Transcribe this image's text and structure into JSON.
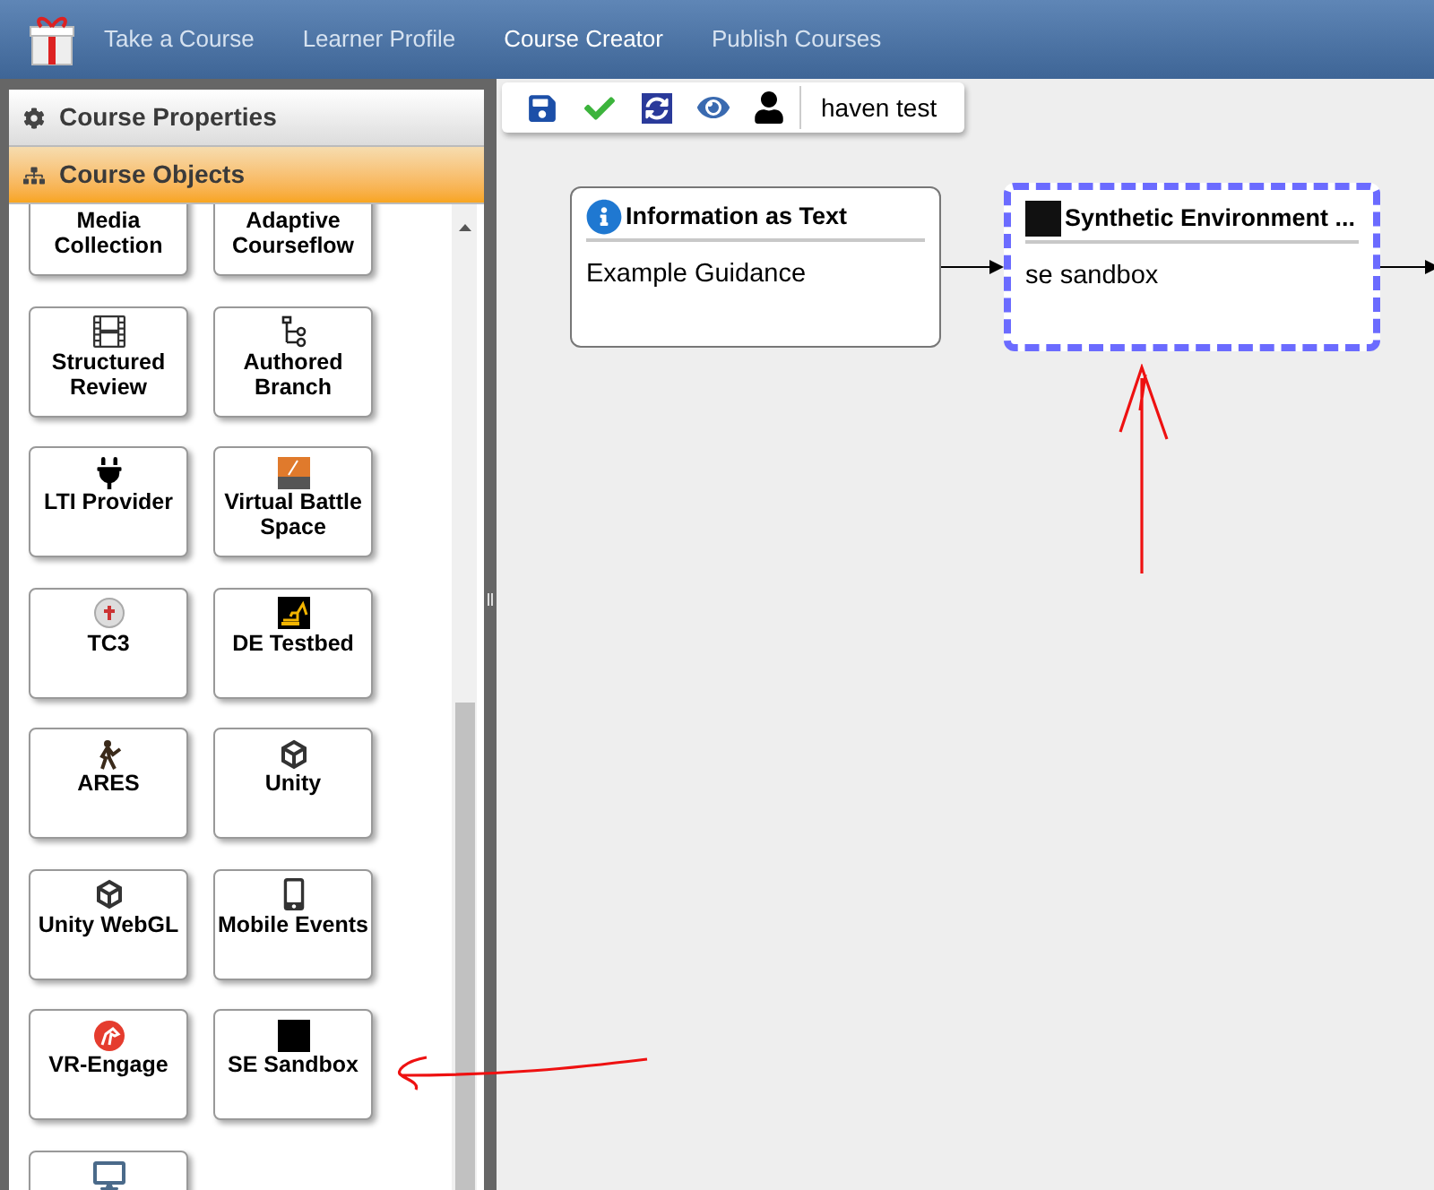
{
  "nav": {
    "items": [
      {
        "label": "Take a Course",
        "selected": false
      },
      {
        "label": "Learner Profile",
        "selected": false
      },
      {
        "label": "Course Creator",
        "selected": true
      },
      {
        "label": "Publish Courses",
        "selected": false
      }
    ]
  },
  "sidebar": {
    "sections": [
      {
        "label": "Course Properties",
        "expanded": false
      },
      {
        "label": "Course Objects",
        "expanded": true
      }
    ],
    "tiles": [
      {
        "label": "Media Collection",
        "kind": "hidden"
      },
      {
        "label": "Adaptive Courseflow",
        "kind": "hidden"
      },
      {
        "label": "Structured Review",
        "kind": "film"
      },
      {
        "label": "Authored Branch",
        "kind": "branch"
      },
      {
        "label": "LTI Provider",
        "kind": "plug"
      },
      {
        "label": "Virtual Battle Space",
        "kind": "vbs"
      },
      {
        "label": "TC3",
        "kind": "medic"
      },
      {
        "label": "DE Testbed",
        "kind": "excavator"
      },
      {
        "label": "ARES",
        "kind": "figure"
      },
      {
        "label": "Unity",
        "kind": "cube"
      },
      {
        "label": "Unity WebGL",
        "kind": "cube"
      },
      {
        "label": "Mobile Events",
        "kind": "phone"
      },
      {
        "label": "VR-Engage",
        "kind": "horse"
      },
      {
        "label": "SE Sandbox",
        "kind": "sandbox"
      },
      {
        "kind": "computer"
      }
    ]
  },
  "toolbar": {
    "user": "haven test"
  },
  "canvas": {
    "nodes": [
      {
        "title": "Information as Text",
        "body": "Example Guidance",
        "selected": false
      },
      {
        "title": "Synthetic Environment ...",
        "body": "se sandbox",
        "selected": true
      }
    ]
  }
}
